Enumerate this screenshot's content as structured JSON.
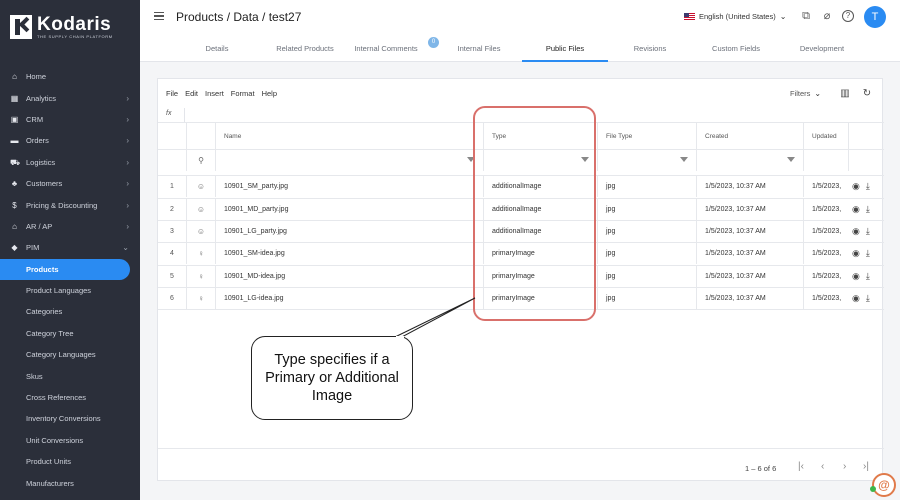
{
  "sidebar": {
    "logo_name": "Kodaris",
    "logo_tagline": "THE SUPPLY CHAIN PLATFORM",
    "items": [
      {
        "label": "Home",
        "icon": "home-icon",
        "glyph": "⌂",
        "chevron": false
      },
      {
        "label": "Analytics",
        "icon": "analytics-icon",
        "glyph": "▦",
        "chevron": true
      },
      {
        "label": "CRM",
        "icon": "crm-icon",
        "glyph": "▣",
        "chevron": true
      },
      {
        "label": "Orders",
        "icon": "orders-icon",
        "glyph": "▬",
        "chevron": true
      },
      {
        "label": "Logistics",
        "icon": "truck-icon",
        "glyph": "⛟",
        "chevron": true
      },
      {
        "label": "Customers",
        "icon": "customers-icon",
        "glyph": "♣",
        "chevron": true
      },
      {
        "label": "Pricing & Discounting",
        "icon": "dollar-icon",
        "glyph": "$",
        "chevron": true
      },
      {
        "label": "AR / AP",
        "icon": "bank-icon",
        "glyph": "⌂",
        "chevron": true
      },
      {
        "label": "PIM",
        "icon": "tag-icon",
        "glyph": "◆",
        "chevron": true
      }
    ],
    "sub_items": [
      "Products",
      "Product Languages",
      "Categories",
      "Category Tree",
      "Category Languages",
      "Skus",
      "Cross References",
      "Inventory Conversions",
      "Unit Conversions",
      "Product Units",
      "Manufacturers"
    ]
  },
  "header": {
    "title": "Products / Data / test27",
    "language": "English (United States)",
    "avatar_initial": "T"
  },
  "tabs": [
    {
      "label": "Details"
    },
    {
      "label": "Related Products"
    },
    {
      "label": "Internal Comments",
      "badge": "0"
    },
    {
      "label": "Internal Files"
    },
    {
      "label": "Public Files",
      "active": true
    },
    {
      "label": "Revisions"
    },
    {
      "label": "Custom Fields"
    },
    {
      "label": "Development"
    }
  ],
  "toolbar": {
    "menu": [
      "File",
      "Edit",
      "Insert",
      "Format",
      "Help"
    ],
    "filters_label": "Filters",
    "fx_label": "fx"
  },
  "grid": {
    "columns": [
      "Name",
      "Type",
      "File Type",
      "Created",
      "Updated"
    ],
    "rows": [
      {
        "num": "1",
        "icon": "☺",
        "name": "10901_SM_party.jpg",
        "type": "additionalImage",
        "file_type": "jpg",
        "created": "1/5/2023, 10:37 AM",
        "updated": "1/5/2023,"
      },
      {
        "num": "2",
        "icon": "☺",
        "name": "10901_MD_party.jpg",
        "type": "additionalImage",
        "file_type": "jpg",
        "created": "1/5/2023, 10:37 AM",
        "updated": "1/5/2023,"
      },
      {
        "num": "3",
        "icon": "☺",
        "name": "10901_LG_party.jpg",
        "type": "additionalImage",
        "file_type": "jpg",
        "created": "1/5/2023, 10:37 AM",
        "updated": "1/5/2023,"
      },
      {
        "num": "4",
        "icon": "♀",
        "name": "10901_SM-idea.jpg",
        "type": "primaryImage",
        "file_type": "jpg",
        "created": "1/5/2023, 10:37 AM",
        "updated": "1/5/2023,"
      },
      {
        "num": "5",
        "icon": "♀",
        "name": "10901_MD-idea.jpg",
        "type": "primaryImage",
        "file_type": "jpg",
        "created": "1/5/2023, 10:37 AM",
        "updated": "1/5/2023,"
      },
      {
        "num": "6",
        "icon": "♀",
        "name": "10901_LG-idea.jpg",
        "type": "primaryImage",
        "file_type": "jpg",
        "created": "1/5/2023, 10:37 AM",
        "updated": "1/5/2023,"
      }
    ],
    "pagination": "1 – 6 of 6"
  },
  "callout": {
    "text": "Type specifies if a Primary or Additional Image"
  },
  "colors": {
    "accent": "#2a8bf2",
    "sidebar_bg": "#2b2f3a",
    "highlight": "#d9706b"
  }
}
